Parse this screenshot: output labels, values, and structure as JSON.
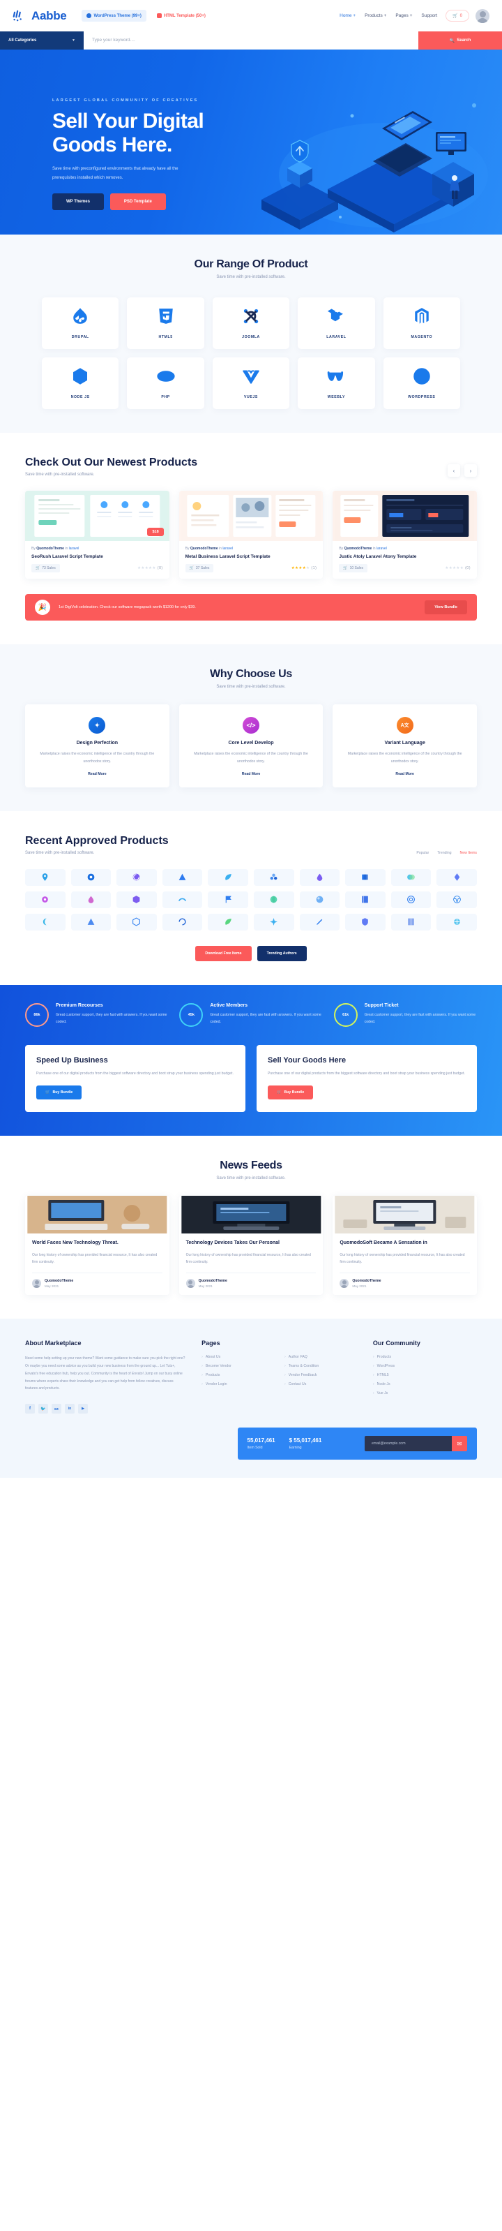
{
  "header": {
    "brand": "Aabbe",
    "badges": [
      {
        "label": "WordPress Theme (99+)",
        "icon": "wordpress-icon"
      },
      {
        "label": "HTML Template (50+)",
        "icon": "html-icon"
      }
    ],
    "nav": [
      {
        "label": "Home +",
        "active": true
      },
      {
        "label": "Products +",
        "active": false
      },
      {
        "label": "Pages +",
        "active": false
      },
      {
        "label": "Support",
        "active": false
      }
    ],
    "cart_count": "0"
  },
  "search": {
    "categories_label": "All Categories",
    "placeholder": "Type your keyword....",
    "button_label": "Search"
  },
  "hero": {
    "eyebrow": "LARGEST GLOBAL COMMUNITY OF CREATIVES",
    "title_line1": "Sell Your Digital",
    "title_line2": "Goods Here.",
    "paragraph": "Save time with preconfigured environments that already have all the prerequisites installed which removes.",
    "btn_primary": "WP Themes",
    "btn_secondary": "PSD Template"
  },
  "range": {
    "title": "Our Range Of Product",
    "subtitle": "Save time with pre-installed software.",
    "items": [
      {
        "label": "DRUPAL",
        "icon": "drupal-icon"
      },
      {
        "label": "HTML5",
        "icon": "html5-icon"
      },
      {
        "label": "JOOMLA",
        "icon": "joomla-icon"
      },
      {
        "label": "LARAVEL",
        "icon": "laravel-icon"
      },
      {
        "label": "MAGENTO",
        "icon": "magento-icon"
      },
      {
        "label": "NODE JS",
        "icon": "nodejs-icon"
      },
      {
        "label": "PHP",
        "icon": "php-icon"
      },
      {
        "label": "VUEJS",
        "icon": "vuejs-icon"
      },
      {
        "label": "WEEBLY",
        "icon": "weebly-icon"
      },
      {
        "label": "WORDPRESS",
        "icon": "wordpress-icon"
      }
    ]
  },
  "products": {
    "title": "Check Out Our Newest Products",
    "subtitle": "Save time with pre-installed software.",
    "prev": "‹",
    "next": "›",
    "items": [
      {
        "by_prefix": "By",
        "author": "QuomodoTheme",
        "in": "in",
        "category": "laravel",
        "name": "SeoRush Laravel Script Template",
        "price": "$18",
        "sales": "73 Sales",
        "rating": 0,
        "rating_count": "(0)"
      },
      {
        "by_prefix": "By",
        "author": "QuomodoTheme",
        "in": "in",
        "category": "laravel",
        "name": "Metal Business Laravel Script Template",
        "price": "",
        "sales": "37 Sales",
        "rating": 4,
        "rating_count": "(1)"
      },
      {
        "by_prefix": "By",
        "author": "QuomodoTheme",
        "in": "in",
        "category": "laravel",
        "name": "Justic Atoly Laravel Atony Template",
        "price": "",
        "sales": "10 Sales",
        "rating": 0,
        "rating_count": "(0)"
      }
    ]
  },
  "promo": {
    "text": "1st DigiVolt celebration. Check our software megapack worth $1200 for only $39.",
    "button": "View Bundle",
    "icon": "celebration-icon"
  },
  "why": {
    "title": "Why Choose Us",
    "subtitle": "Save time with pre-installed software.",
    "cards": [
      {
        "title": "Design Perfection",
        "icon": "magic-wand-icon",
        "body": "Marketplace raises the economic intelligence of the country through the unorthodox story.",
        "link": "Read More"
      },
      {
        "title": "Core Level Develop",
        "icon": "code-icon",
        "body": "Marketplace raises the economic intelligence of the country through the unorthodox story.",
        "link": "Read More"
      },
      {
        "title": "Variant Language",
        "icon": "language-icon",
        "body": "Marketplace raises the economic intelligence of the country through the unorthodox story.",
        "link": "Read More"
      }
    ]
  },
  "recent": {
    "title": "Recent Approved Products",
    "subtitle": "Save time with pre-installed software.",
    "tabs": [
      {
        "label": "Popular",
        "active": false
      },
      {
        "label": "Trending",
        "active": false
      },
      {
        "label": "New Items",
        "active": true
      }
    ],
    "btn_download": "Download Free Items",
    "btn_trending": "Trending Authors"
  },
  "stats": {
    "items": [
      {
        "value": "86k",
        "title": "Premium Recourses",
        "body": "Great customer support, they are fast with answers. If you want some coded.",
        "color": "#ff9a8b"
      },
      {
        "value": "45k",
        "title": "Active Members",
        "body": "Great customer support, they are fast with answers. If you want some coded.",
        "color": "#3fd2f7"
      },
      {
        "value": "61k",
        "title": "Support Ticket",
        "body": "Great customer support, they are fast with answers. If you want some coded.",
        "color": "#d4f55a"
      }
    ],
    "cta": [
      {
        "title": "Speed Up Business",
        "body": "Purchase one of our digital products from the biggest software directory and boot strap your business spending just budget.",
        "button": "Buy Bundle",
        "style": "blue"
      },
      {
        "title": "Sell Your Goods Here",
        "body": "Purchase one of our digital products from the biggest software directory and boot strap your business spending just budget.",
        "button": "Buy Bundle",
        "style": "red"
      }
    ]
  },
  "news": {
    "title": "News Feeds",
    "subtitle": "Save time with pre-installed software.",
    "items": [
      {
        "title": "World Faces New Technology Threat.",
        "body": "Our long history of ownership has provided financial resource, It has also created firm continuity.",
        "author": "QuomodoTheme",
        "date": "May 2021"
      },
      {
        "title": "Technology Devices Takes Our Personal",
        "body": "Our long history of ownership has provided financial resource, It has also created firm continuity.",
        "author": "QuomodoTheme",
        "date": "May 2021"
      },
      {
        "title": "QuomodoSoft Became A Sensation in",
        "body": "Our long history of ownership has provided financial resource, It has also created firm continuity.",
        "author": "QuomodoTheme",
        "date": "May 2021"
      }
    ]
  },
  "footer": {
    "about_title": "About Marketplace",
    "about_body": "Need some help setting up your new theme? Want some guidance to make sure you pick the right one? Or maybe you need some advice as you build your new business from the ground up... Let Tuts+, Envato's free education hub, help you out. Community is the heart of Envato! Jump on our busy online forums where experts share their knowledge and you can get help from fellow creatives, discuss features and products.",
    "pages_title": "Pages",
    "pages_col1": [
      "About Us",
      "Become Vendor",
      "Products",
      "Vendor Login"
    ],
    "pages_col2": [
      "Author FAQ",
      "Teams & Condition",
      "Vendor Feedback",
      "Contact Us"
    ],
    "community_title": "Our Community",
    "community_items": [
      "Products",
      "WordPress",
      "HTML5",
      "Node Js",
      "Vue Js"
    ],
    "socials": [
      "facebook-icon",
      "twitter-icon",
      "behance-icon",
      "linkedin-icon",
      "youtube-icon"
    ],
    "newsletter": {
      "sold_value": "55,017,461",
      "sold_label": "Item Sold",
      "earning_value": "$ 55,017,461",
      "earning_label": "Earning",
      "email_placeholder": "email@example.com",
      "submit_icon": "envelope-icon"
    }
  }
}
